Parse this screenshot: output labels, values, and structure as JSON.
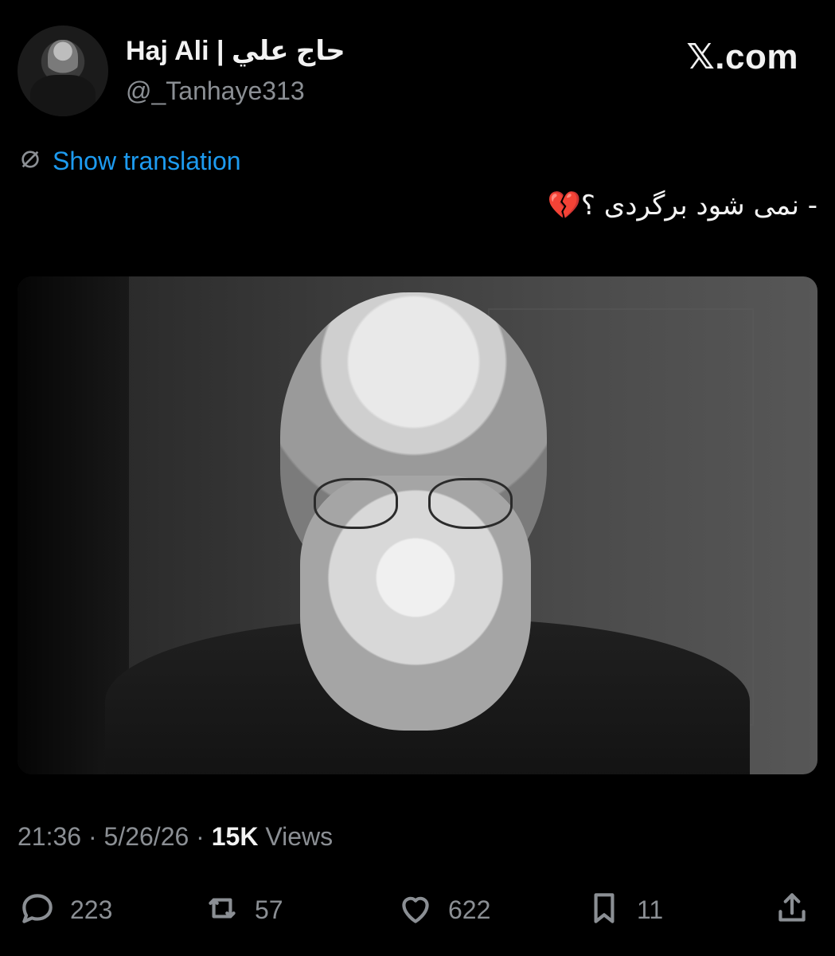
{
  "header": {
    "display_name": "Haj Ali | حاج علي",
    "handle": "@_Tanhaye313",
    "site_label": "𝕏.com"
  },
  "translation": {
    "label": "Show translation"
  },
  "tweet": {
    "text": "- نمی شود برگردی ؟💔"
  },
  "meta": {
    "time": "21:36",
    "date": "5/26/26",
    "views_count": "15K",
    "views_label": "Views",
    "separator": "·"
  },
  "actions": {
    "replies": "223",
    "reposts": "57",
    "likes": "622",
    "bookmarks": "11"
  },
  "icons": {
    "reply": "reply-icon",
    "repost": "repost-icon",
    "like": "heart-icon",
    "bookmark": "bookmark-icon",
    "share": "share-icon",
    "translate": "translate-icon"
  },
  "colors": {
    "background": "#000000",
    "text": "#e7e9ea",
    "secondary": "#8b8f94",
    "link": "#1d9bf0"
  }
}
